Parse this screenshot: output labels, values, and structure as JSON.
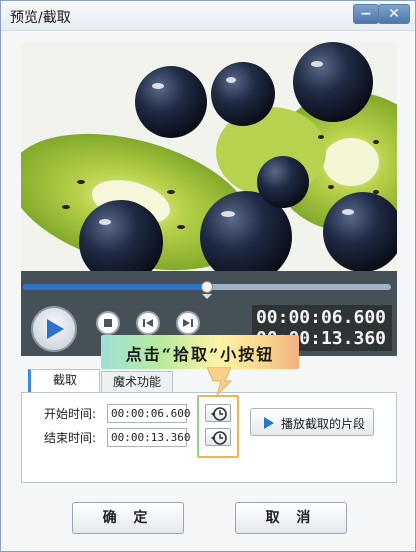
{
  "window": {
    "title": "预览/截取",
    "minimize_icon": "minimize-icon",
    "close_icon": "close-icon"
  },
  "video": {
    "content": "kiwi and blueberries close-up",
    "progress": 0.5
  },
  "controls": {
    "play_icon": "play-icon",
    "stop_icon": "stop-icon",
    "prev_frame_icon": "prev-frame-icon",
    "next_frame_icon": "next-frame-icon",
    "current_time": "00:00:06.600",
    "end_time": "00:00:13.360",
    "accent": "#2f73c9"
  },
  "tabs": [
    {
      "label": "截取"
    },
    {
      "label": "魔术功能"
    }
  ],
  "clip": {
    "start_label": "开始时间:",
    "start_value": "00:00:06.600",
    "end_label": "结束时间:",
    "end_value": "00:00:13.360",
    "pick_icon": "clock-pick-icon",
    "play_clip_label": "播放截取的片段"
  },
  "callout": {
    "text": "点击“拾取”小按钮"
  },
  "footer": {
    "ok_label": "确 定",
    "cancel_label": "取 消"
  }
}
